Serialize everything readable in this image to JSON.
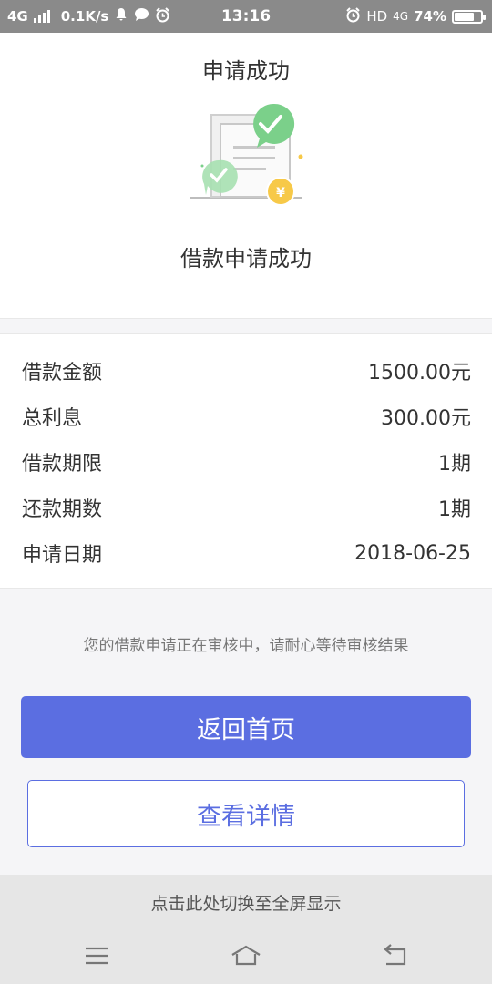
{
  "status_bar": {
    "network": "4G",
    "speed": "0.1K/s",
    "time": "13:16",
    "hd": "HD",
    "net_right": "4G",
    "battery_percent": "74%",
    "battery_level": 0.74
  },
  "header": {
    "title": "申请成功"
  },
  "result": {
    "title": "借款申请成功",
    "illustration_icon": "document-check-coin-icon"
  },
  "details": [
    {
      "label": "借款金额",
      "value": "1500.00元"
    },
    {
      "label": "总利息",
      "value": "300.00元"
    },
    {
      "label": "借款期限",
      "value": "1期"
    },
    {
      "label": "还款期数",
      "value": "1期"
    },
    {
      "label": "申请日期",
      "value": "2018-06-25"
    }
  ],
  "notice": "您的借款申请正在审核中，请耐心等待审核结果",
  "buttons": {
    "home": "返回首页",
    "details": "查看详情"
  },
  "system": {
    "fullscreen_hint": "点击此处切换至全屏显示"
  },
  "colors": {
    "accent": "#5b6ee1",
    "success_green": "#7bd08a",
    "coin_yellow": "#f7c948"
  }
}
